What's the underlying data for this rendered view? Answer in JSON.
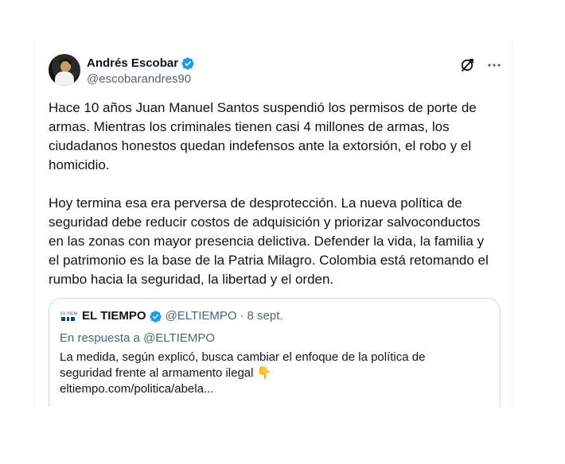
{
  "tweet": {
    "author_name": "Andrés Escobar",
    "author_handle": "@escobarandres90",
    "text": "Hace 10 años Juan Manuel Santos suspendió los permisos de porte de armas. Mientras los criminales tienen casi 4 millones de armas, los ciudadanos honestos quedan indefensos ante la extorsión, el robo y el homicidio.\n\nHoy termina esa era perversa de desprotección. La nueva política de seguridad debe reducir costos de adquisición y priorizar salvoconductos en las zonas con mayor presencia delictiva. Defender la vida, la familia y el patrimonio es la base de la Patria Milagro. Colombia está retomando el rumbo hacia la seguridad, la libertad y el orden."
  },
  "quoted": {
    "author_name": "EL TIEMPO",
    "author_handle": "@ELTIEMPO",
    "separator": "·",
    "date": "8 sept.",
    "reply_to": "En respuesta a @ELTIEMPO",
    "line1": "La medida, según explicó, busca cambiar el enfoque de la política de",
    "line2": "seguridad frente al armamento ilegal 👇",
    "link": "eltiempo.com/politica/abela..."
  },
  "icons": {
    "verified": "verified-badge-icon",
    "grok": "grok-icon",
    "more": "more-icon",
    "quoted_logo": "el-tiempo-logo"
  },
  "colors": {
    "text": "#0f1419",
    "secondary": "#536471",
    "verified": "#1d9bf0",
    "border": "#cfd9de"
  }
}
